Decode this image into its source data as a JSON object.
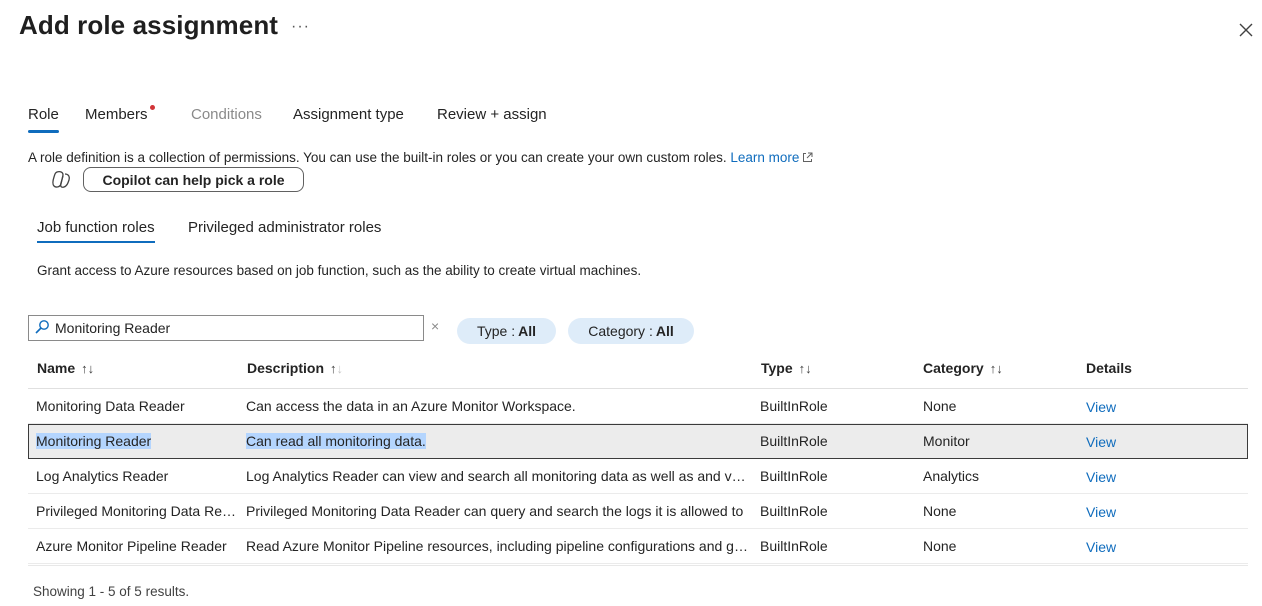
{
  "header": {
    "title": "Add role assignment",
    "more_label": "···"
  },
  "tabs": [
    {
      "label": "Role",
      "active": true,
      "disabled": false
    },
    {
      "label": "Members",
      "active": false,
      "disabled": false
    },
    {
      "label": "Conditions",
      "active": false,
      "disabled": true
    },
    {
      "label": "Assignment type",
      "active": false,
      "disabled": false
    },
    {
      "label": "Review + assign",
      "active": false,
      "disabled": false
    }
  ],
  "intro": {
    "text": "A role definition is a collection of permissions. You can use the built-in roles or you can create your own custom roles.",
    "learn_more": "Learn more"
  },
  "copilot": {
    "button_label": "Copilot can help pick a role"
  },
  "subtabs": [
    {
      "label": "Job function roles",
      "active": true
    },
    {
      "label": "Privileged administrator roles",
      "active": false
    }
  ],
  "grant_text": "Grant access to Azure resources based on job function, such as the ability to create virtual machines.",
  "search": {
    "value": "Monitoring Reader",
    "clear_label": "×"
  },
  "filters": {
    "type": {
      "label": "Type :",
      "value": "All"
    },
    "category": {
      "label": "Category :",
      "value": "All"
    }
  },
  "table": {
    "columns": {
      "name": "Name",
      "description": "Description",
      "type": "Type",
      "category": "Category",
      "details": "Details"
    },
    "sort_arrows": "↑↓",
    "rows": [
      {
        "name": "Monitoring Data Reader",
        "description": "Can access the data in an Azure Monitor Workspace.",
        "type": "BuiltInRole",
        "category": "None",
        "details": "View"
      },
      {
        "name": "Monitoring Reader",
        "description": "Can read all monitoring data.",
        "type": "BuiltInRole",
        "category": "Monitor",
        "details": "View"
      },
      {
        "name": "Log Analytics Reader",
        "description": "Log Analytics Reader can view and search all monitoring data as well as and view monitoring settings",
        "type": "BuiltInRole",
        "category": "Analytics",
        "details": "View"
      },
      {
        "name": "Privileged Monitoring Data Reader",
        "description": "Privileged Monitoring Data Reader can query and search the logs it is allowed to",
        "type": "BuiltInRole",
        "category": "None",
        "details": "View"
      },
      {
        "name": "Azure Monitor Pipeline Reader",
        "description": "Read Azure Monitor Pipeline resources, including pipeline configurations and groups",
        "type": "BuiltInRole",
        "category": "None",
        "details": "View"
      }
    ]
  },
  "footer": {
    "showing": "Showing 1 - 5 of 5 results."
  },
  "colors": {
    "accent": "#0f6cbd",
    "pill_bg": "#deecf9",
    "selected_row_bg": "#ececec",
    "text_highlight": "#b4d5fe",
    "notification_dot": "#d13438"
  }
}
